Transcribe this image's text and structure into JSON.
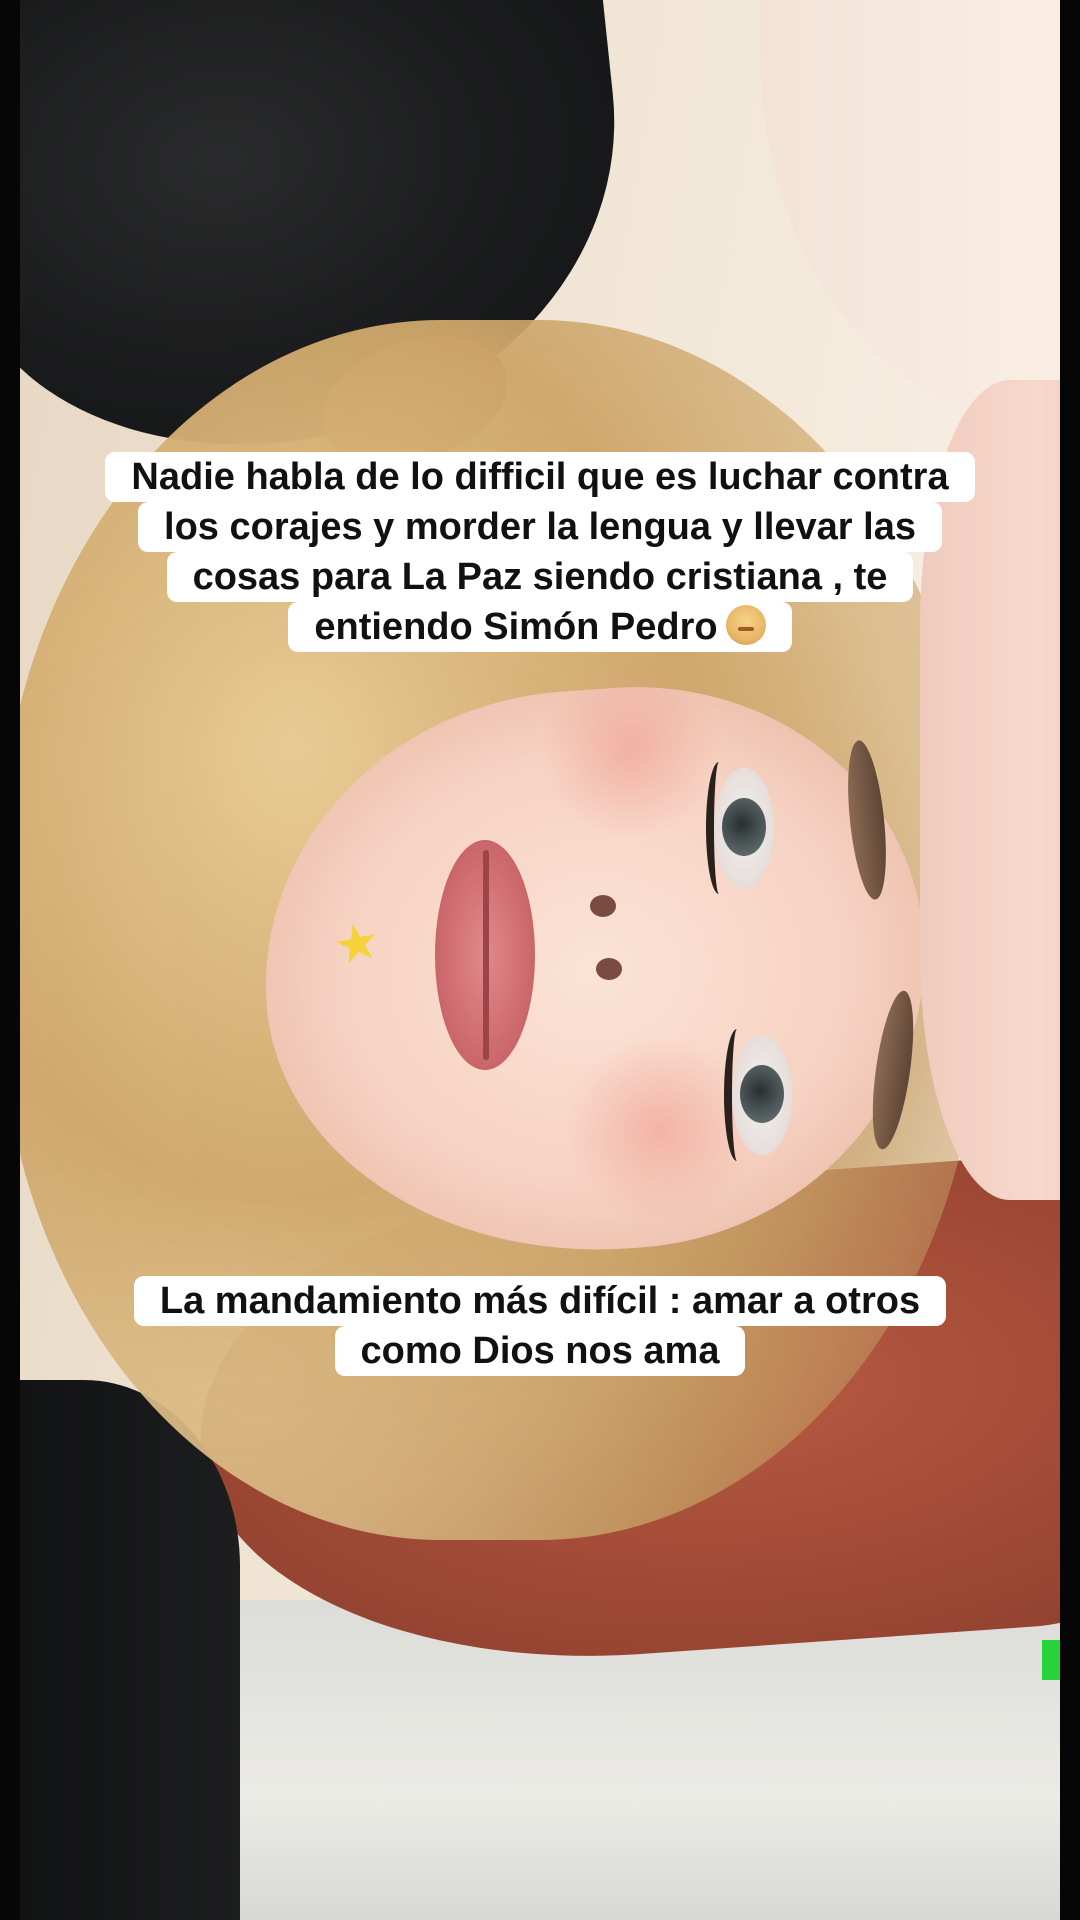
{
  "caption_top": {
    "lines": [
      "Nadie habla de lo difficil que es luchar contra",
      "los corajes y morder la lengua y llevar las",
      "cosas para La Paz siendo cristiana , te",
      "entiendo Simón Pedro"
    ],
    "emoji": "woman-getting-massage-emoji"
  },
  "caption_bottom": {
    "lines": [
      "La mandamiento más difícil : amar a otros",
      "como Dios nos ama"
    ]
  },
  "sticker": {
    "icon": "star-icon",
    "color": "#f5d23a"
  },
  "colors": {
    "caption_bg": "#ffffff",
    "caption_text": "#111111",
    "side_bars": "#060606"
  }
}
